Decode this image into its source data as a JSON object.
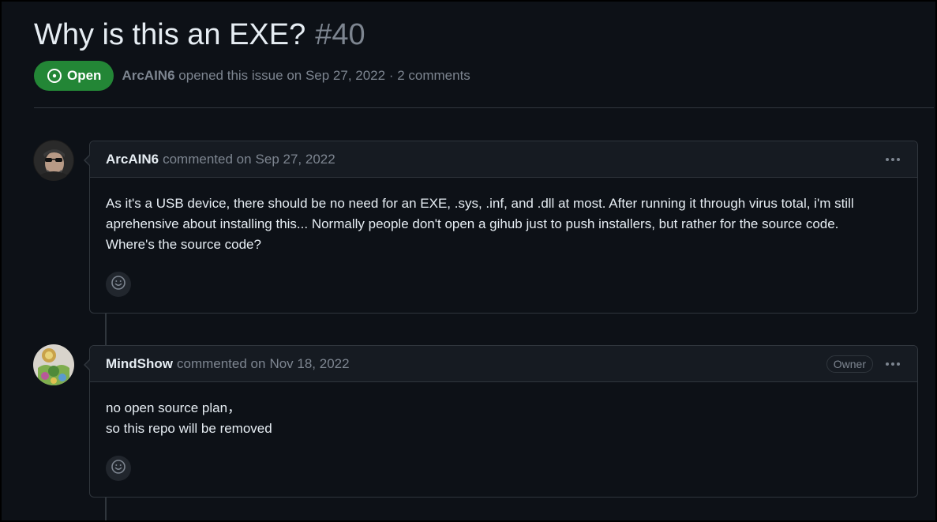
{
  "issue": {
    "title": "Why is this an EXE?",
    "number": "#40",
    "state": "Open",
    "author": "ArcAIN6",
    "meta_suffix": "opened this issue on Sep 27, 2022 · 2 comments"
  },
  "comments": [
    {
      "author": "ArcAIN6",
      "action": "commented on",
      "date": "Sep 27, 2022",
      "body_lines": [
        "As it's a USB device, there should be no need for an EXE, .sys, .inf, and .dll at most. After running it through virus total, i'm still",
        "aprehensive about installing this... Normally people don't open a gihub just to push installers, but rather for the source code.",
        "Where's the source code?"
      ]
    },
    {
      "author": "MindShow",
      "action": "commented on",
      "date": "Nov 18, 2022",
      "badge": "Owner",
      "body_lines": [
        "no open source plan，",
        "so this repo will be removed"
      ]
    }
  ],
  "icons": {
    "state": "issue-opened-icon",
    "menu": "kebab-horizontal-icon",
    "reaction": "smiley-icon"
  },
  "colors": {
    "background": "#0d1117",
    "open_green": "#238636",
    "muted_text": "#7d8590",
    "border": "#30363d"
  }
}
